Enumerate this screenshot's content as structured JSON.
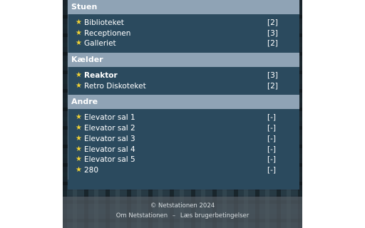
{
  "colors": {
    "header_bg": "#8fa3b5",
    "panel_bg": "#2b4a5e",
    "star": "#f2d335",
    "text": "#ffffff"
  },
  "sections": [
    {
      "title": "Stuen",
      "rooms": [
        {
          "name": "Biblioteket",
          "count": "[2]",
          "bold": false
        },
        {
          "name": "Receptionen",
          "count": "[3]",
          "bold": false
        },
        {
          "name": "Galleriet",
          "count": "[2]",
          "bold": false
        }
      ]
    },
    {
      "title": "Kælder",
      "rooms": [
        {
          "name": "Reaktor",
          "count": "[3]",
          "bold": true
        },
        {
          "name": "Retro Diskoteket",
          "count": "[2]",
          "bold": false
        }
      ]
    },
    {
      "title": "Andre",
      "rooms": [
        {
          "name": "Elevator sal 1",
          "count": "[-]",
          "bold": false
        },
        {
          "name": "Elevator sal 2",
          "count": "[-]",
          "bold": false
        },
        {
          "name": "Elevator sal 3",
          "count": "[-]",
          "bold": false
        },
        {
          "name": "Elevator sal 4",
          "count": "[-]",
          "bold": false
        },
        {
          "name": "Elevator sal 5",
          "count": "[-]",
          "bold": false
        },
        {
          "name": "280",
          "count": "[-]",
          "bold": false
        }
      ]
    }
  ],
  "icons": {
    "room_icon": "star-icon"
  },
  "footer": {
    "copyright": "© Netstationen 2024",
    "about_link": "Om Netstationen",
    "separator": "–",
    "terms_link": "Læs brugerbetingelser"
  }
}
